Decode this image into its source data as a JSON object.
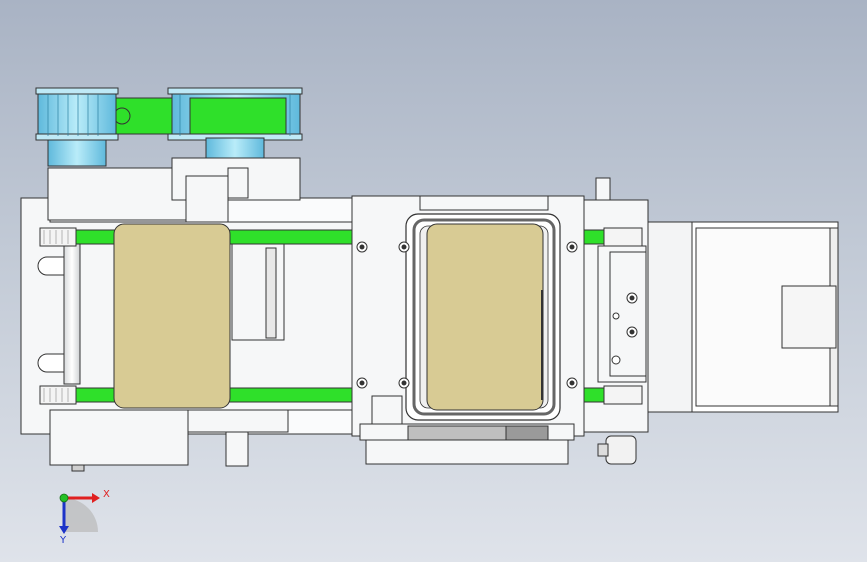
{
  "viewport": {
    "background_top": "#a9b3c4",
    "background_bottom": "#dfe3ea"
  },
  "colors": {
    "belt_green": "#2fe02a",
    "plate_tan": "#d8cb94",
    "pulley_cyan": "#7fd3ee",
    "frame_white": "#f6f7f8",
    "outline": "#333333"
  },
  "triad": {
    "x_label": "X",
    "y_label": "Y",
    "x_color": "#e02020",
    "y_color": "#1c33c8",
    "origin_color": "#25c025"
  }
}
